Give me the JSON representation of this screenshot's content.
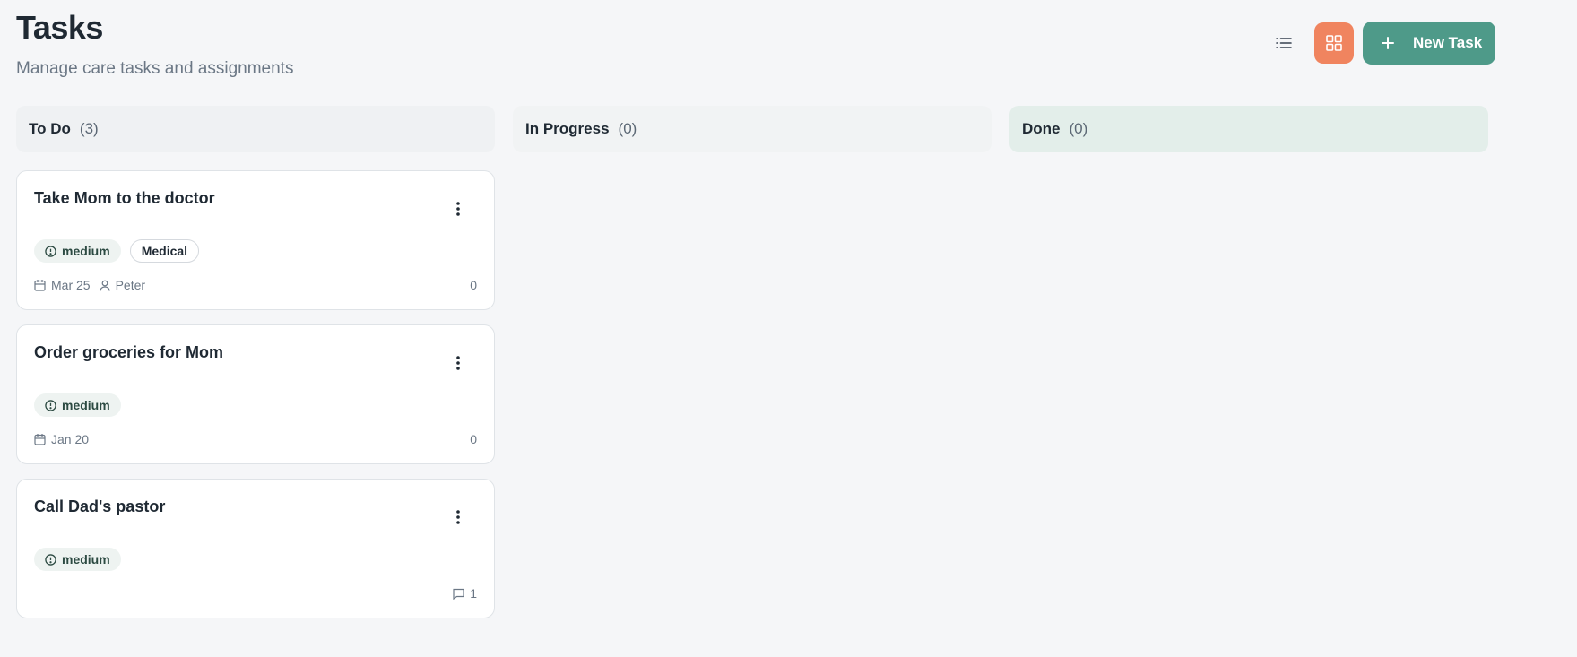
{
  "header": {
    "title": "Tasks",
    "subtitle": "Manage care tasks and assignments"
  },
  "toolbar": {
    "list_view_icon": "list-icon",
    "grid_view_icon": "grid-icon",
    "active_view": "grid",
    "new_task_label": "New Task",
    "colors": {
      "grid_active": "#f0845f",
      "new_task": "#4e9a89"
    }
  },
  "columns": [
    {
      "name": "To Do",
      "count": "(3)"
    },
    {
      "name": "In Progress",
      "count": "(0)"
    },
    {
      "name": "Done",
      "count": "(0)"
    }
  ],
  "cards": [
    {
      "title": "Take Mom to the doctor",
      "priority": "medium",
      "category": "Medical",
      "date": "Mar 25",
      "assignee": "Peter",
      "count": "0"
    },
    {
      "title": "Order groceries for Mom",
      "priority": "medium",
      "date": "Jan 20",
      "count": "0"
    },
    {
      "title": "Call Dad's pastor",
      "priority": "medium",
      "comments": "1"
    }
  ]
}
